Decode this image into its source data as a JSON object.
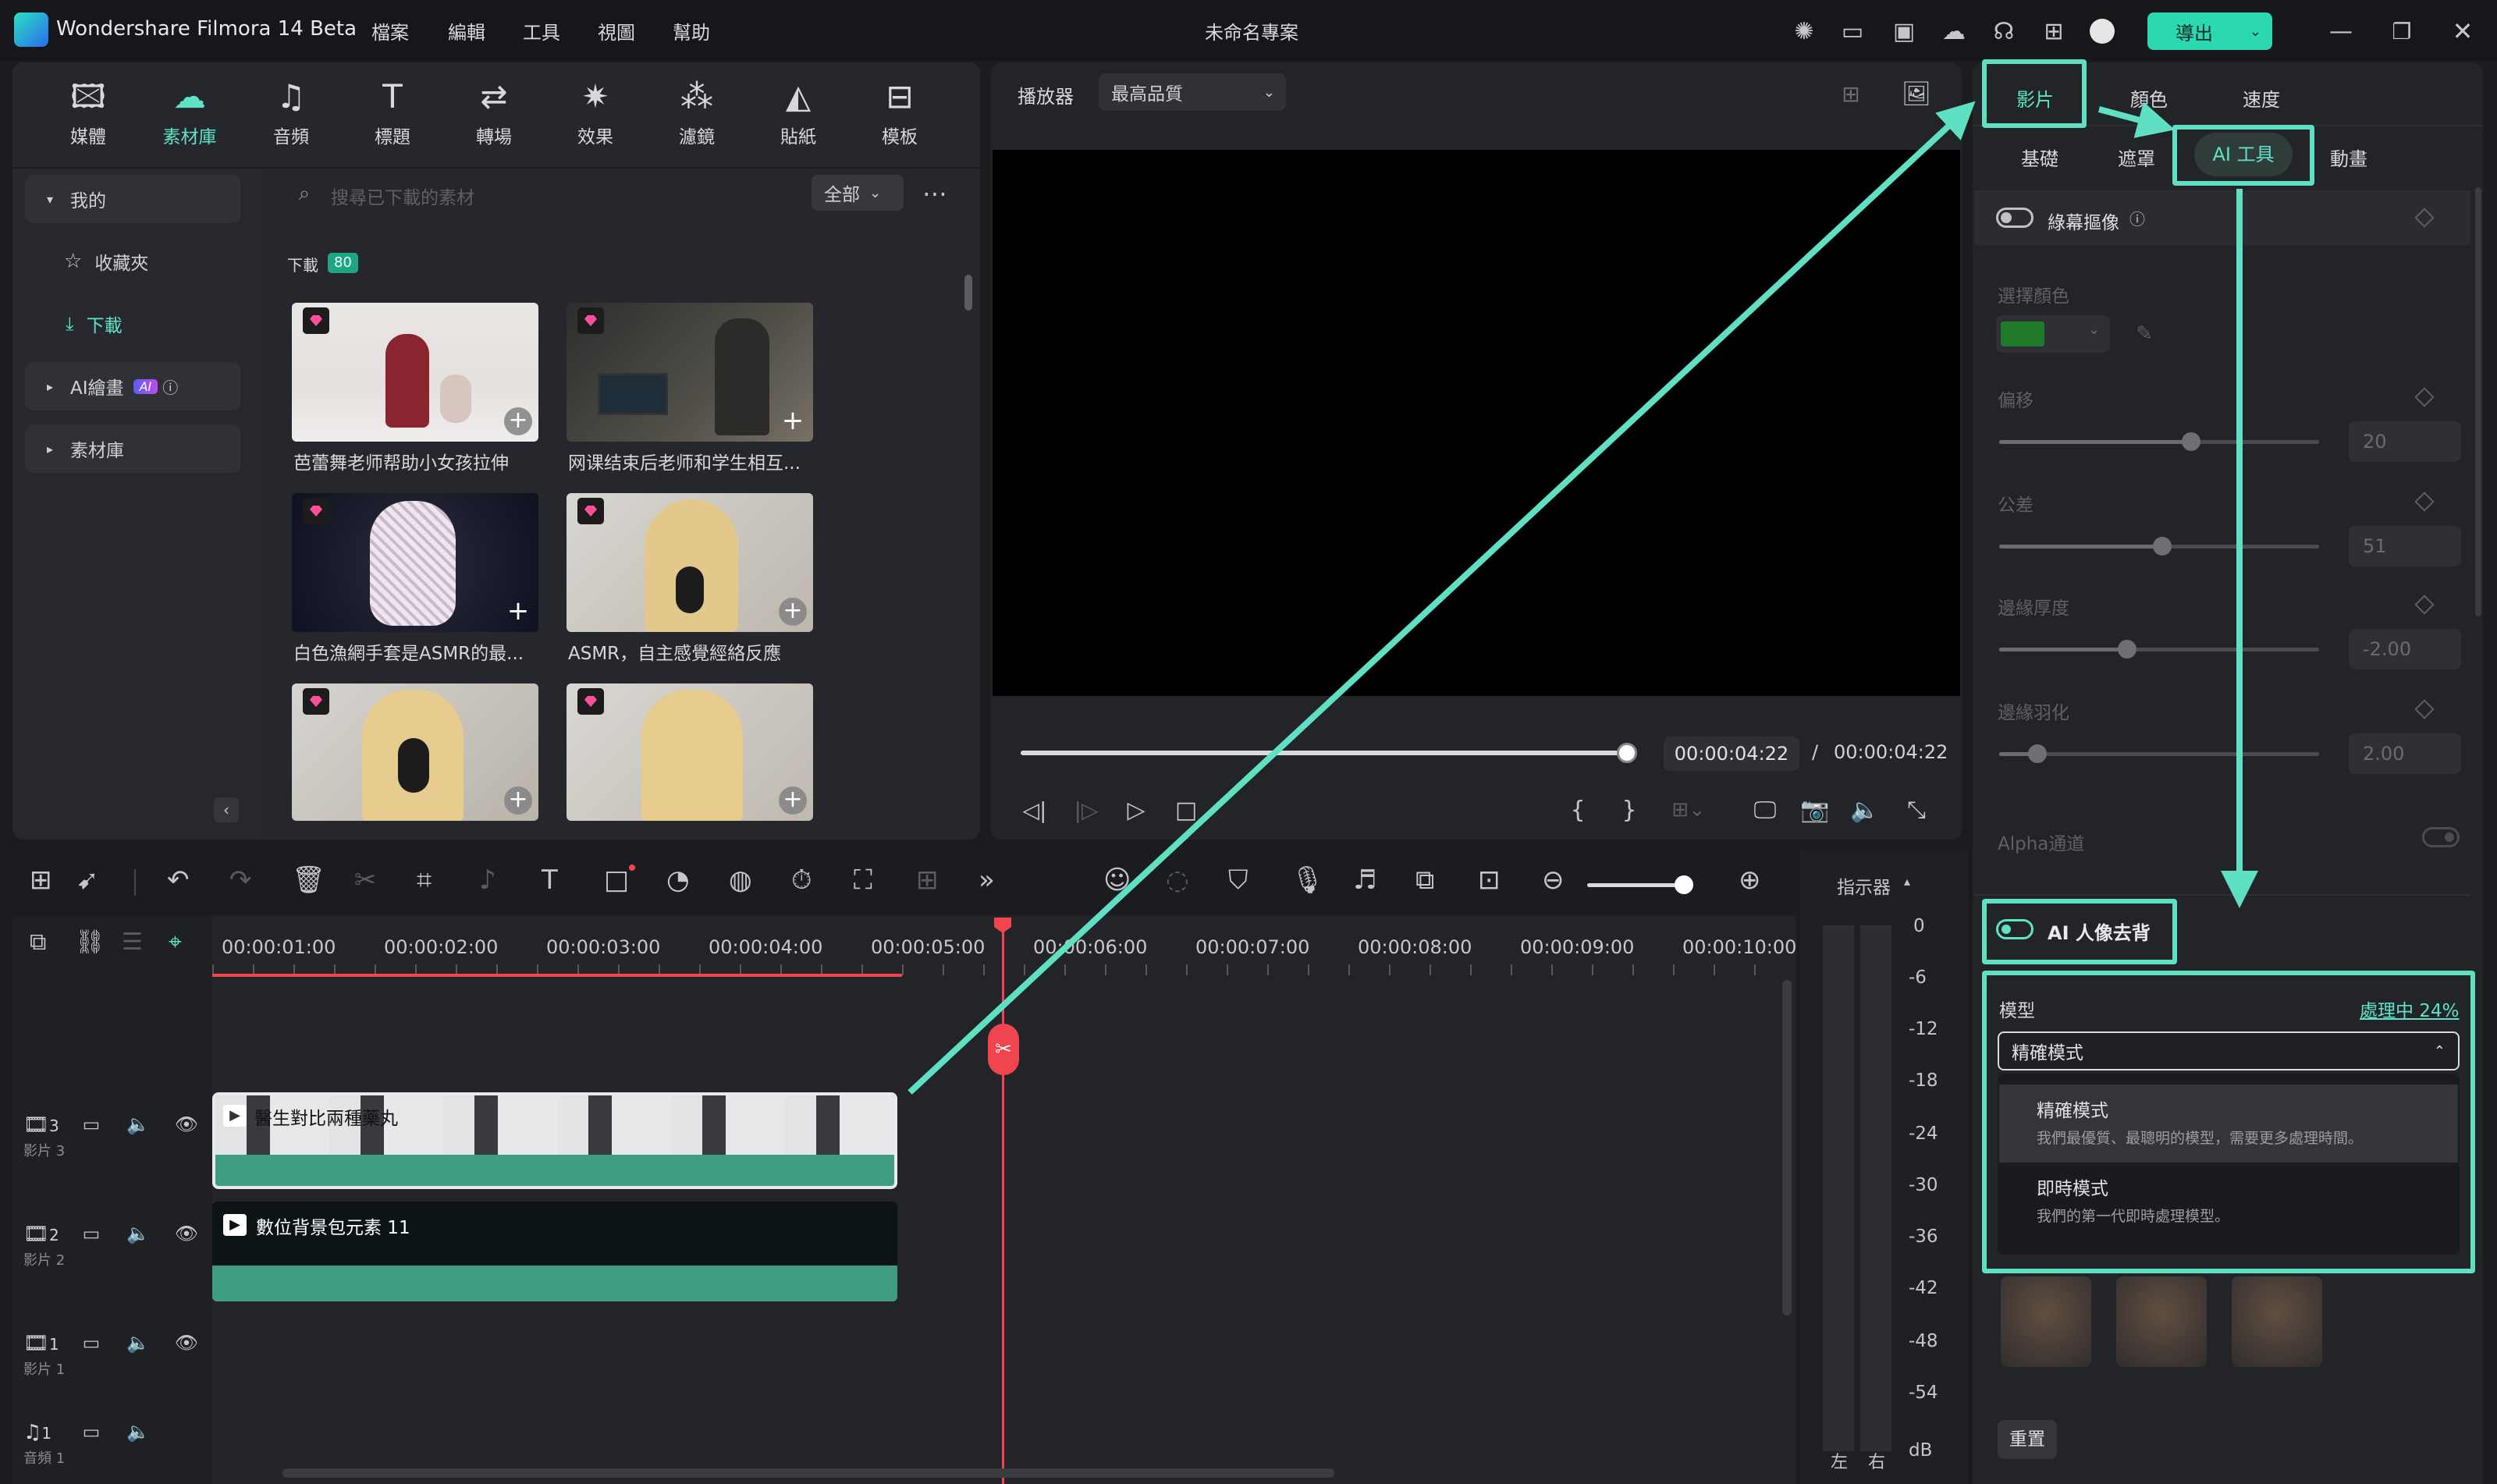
{
  "app": {
    "title": "Wondershare Filmora 14 Beta",
    "project": "未命名專案",
    "menu": [
      "檔案",
      "編輯",
      "工具",
      "視圖",
      "幫助"
    ],
    "export": "導出"
  },
  "library": {
    "tabs": [
      {
        "label": "媒體",
        "icon": "media-icon"
      },
      {
        "label": "素材庫",
        "icon": "stock-icon",
        "active": true
      },
      {
        "label": "音頻",
        "icon": "music-note-icon"
      },
      {
        "label": "標題",
        "icon": "title-t-icon"
      },
      {
        "label": "轉場",
        "icon": "transition-icon"
      },
      {
        "label": "效果",
        "icon": "effects-icon"
      },
      {
        "label": "濾鏡",
        "icon": "filters-icon"
      },
      {
        "label": "貼紙",
        "icon": "sticker-icon"
      },
      {
        "label": "模板",
        "icon": "template-icon"
      }
    ],
    "sidebar": {
      "mine": "我的",
      "favorites": "收藏夾",
      "downloads": "下載",
      "ai_draw": "AI繪畫",
      "ai_badge": "AI",
      "stock": "素材庫"
    },
    "search_placeholder": "搜尋已下載的素材",
    "filter": "全部",
    "section": "下載",
    "count": "80",
    "items": [
      {
        "caption": "芭蕾舞老师帮助小女孩拉伸"
      },
      {
        "caption": "网课结束后老师和学生相互..."
      },
      {
        "caption": "白色漁網手套是ASMR的最..."
      },
      {
        "caption": "ASMR，自主感覺經絡反應"
      },
      {
        "caption": ""
      },
      {
        "caption": ""
      }
    ]
  },
  "player": {
    "label": "播放器",
    "quality": "最高品質",
    "current": "00:00:04:22",
    "sep": "/",
    "total": "00:00:04:22",
    "progress": 1.0
  },
  "props": {
    "tabs": [
      "影片",
      "顏色",
      "速度"
    ],
    "subtabs": [
      "基礎",
      "遮罩",
      "AI 工具",
      "動畫"
    ],
    "chroma": "綠幕摳像",
    "select_color": "選擇顏色",
    "key_color": "#1f7a2a",
    "params": [
      {
        "label": "偏移",
        "value": "20",
        "pos": 0.6
      },
      {
        "label": "公差",
        "value": "51",
        "pos": 0.51
      },
      {
        "label": "邊緣厚度",
        "value": "-2.00",
        "pos": 0.4
      },
      {
        "label": "邊緣羽化",
        "value": "2.00",
        "pos": 0.12
      }
    ],
    "alpha": "Alpha通道",
    "ai_portrait": "AI 人像去背",
    "model_label": "模型",
    "processing": "處理中 24%",
    "model_value": "精確模式",
    "options": [
      {
        "title": "精確模式",
        "desc": "我們最優質、最聰明的模型，需要更多處理時間。"
      },
      {
        "title": "即時模式",
        "desc": "我們的第一代即時處理模型。"
      }
    ],
    "reset": "重置"
  },
  "timeline": {
    "ticks": [
      "00:00:01:00",
      "00:00:02:00",
      "00:00:03:00",
      "00:00:04:00",
      "00:00:05:00",
      "00:00:06:00",
      "00:00:07:00",
      "00:00:08:00",
      "00:00:09:00",
      "00:00:10:00"
    ],
    "tracks": [
      {
        "num": "3",
        "name": "影片 3"
      },
      {
        "num": "2",
        "name": "影片 2"
      },
      {
        "num": "1",
        "name": "影片 1"
      },
      {
        "num": "1",
        "name": "音頻 1"
      }
    ],
    "clip1": "醫生對比兩種藥丸",
    "clip2": "數位背景包元素 11",
    "meter_label": "指示器",
    "db": [
      "0",
      "-6",
      "-12",
      "-18",
      "-24",
      "-30",
      "-36",
      "-42",
      "-48",
      "-54",
      "dB"
    ],
    "lr": [
      "左",
      "右"
    ]
  },
  "colors": {
    "accent": "#5fe3c7",
    "highlight": "#5fe0c3",
    "playhead": "#f0454f",
    "clip": "#3f9b82"
  }
}
